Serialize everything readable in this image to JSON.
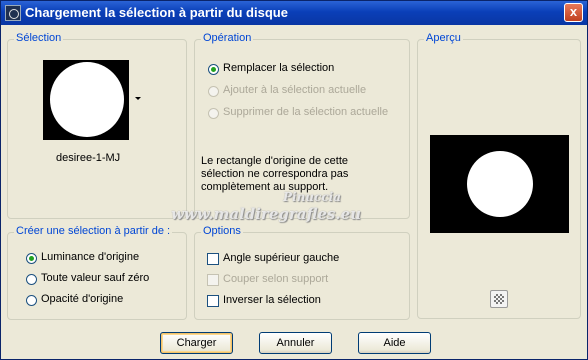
{
  "window": {
    "title": "Chargement la sélection à partir du disque",
    "close_symbol": "x"
  },
  "selection": {
    "legend": "Sélection",
    "thumbnail_icon": "white-circle-selection-thumbnail",
    "name": "desiree-1-MJ"
  },
  "operation": {
    "legend": "Opération",
    "options": [
      {
        "label": "Remplacer la sélection",
        "checked": true,
        "enabled": true
      },
      {
        "label": "Ajouter à la sélection actuelle",
        "checked": false,
        "enabled": false
      },
      {
        "label": "Supprimer de la sélection actuelle",
        "checked": false,
        "enabled": false
      }
    ],
    "note": "Le rectangle d'origine de cette sélection ne correspondra pas complètement au support.",
    "note_lines": [
      "Le rectangle d'origine de cette",
      "sélection ne correspondra pas",
      "complètement au support."
    ]
  },
  "preview": {
    "legend": "Aperçu",
    "checker_icon": "transparency-checker-icon"
  },
  "create_from": {
    "legend": "Créer une sélection à partir de :",
    "options": [
      {
        "label": "Luminance d'origine",
        "checked": true
      },
      {
        "label": "Toute valeur sauf zéro",
        "checked": false
      },
      {
        "label": "Opacité d'origine",
        "checked": false
      }
    ]
  },
  "options": {
    "legend": "Options",
    "items": [
      {
        "label": "Angle supérieur gauche",
        "checked": false,
        "enabled": true
      },
      {
        "label": "Couper selon support",
        "checked": false,
        "enabled": false
      },
      {
        "label": "Inverser la sélection",
        "checked": false,
        "enabled": true
      }
    ]
  },
  "buttons": {
    "load": "Charger",
    "cancel": "Annuler",
    "help": "Aide"
  },
  "watermark": {
    "line1": "Pinuccia",
    "line2": "www.maldiregrafles.eu"
  },
  "colors": {
    "title_bar": "#0a3fb8",
    "legend_text": "#0046d5",
    "dialog_bg": "#ece9d8",
    "radio_dot": "#21a121"
  }
}
